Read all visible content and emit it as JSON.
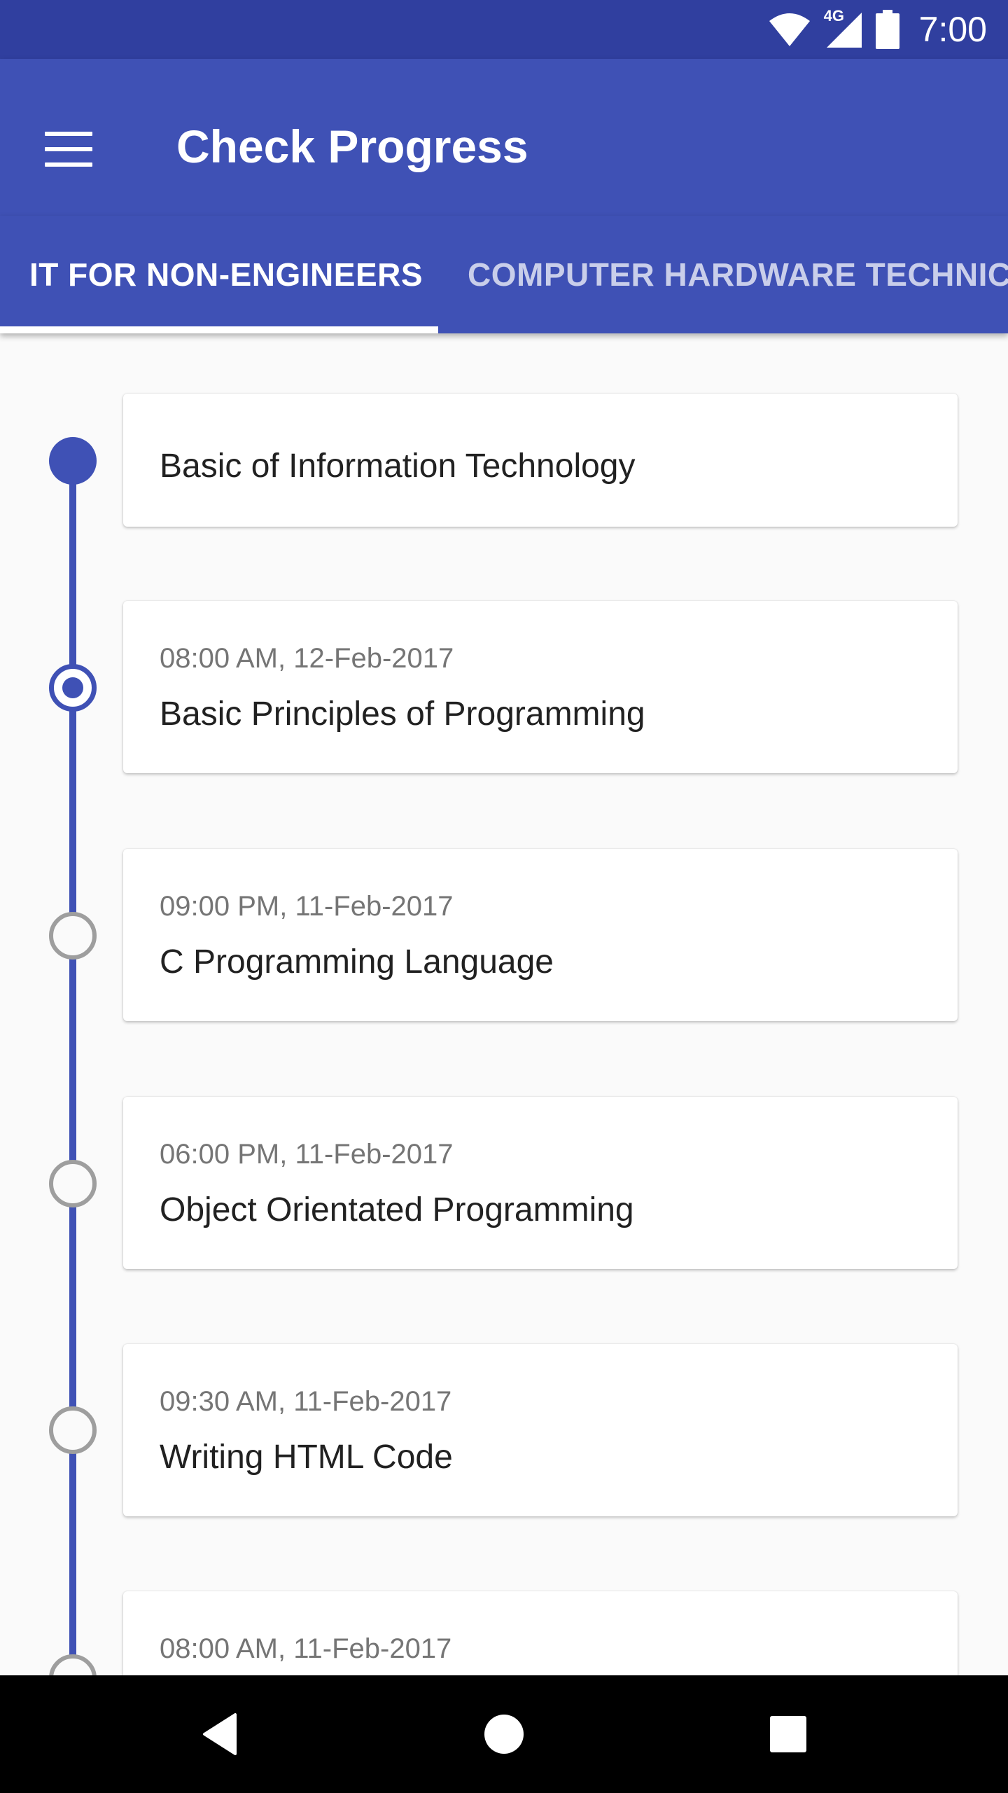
{
  "status_bar": {
    "time": "7:00",
    "network": "4G"
  },
  "app_bar": {
    "title": "Check Progress"
  },
  "tabs": [
    {
      "label": "IT FOR NON-ENGINEERS",
      "active": true
    },
    {
      "label": "COMPUTER HARDWARE TECHNICIAN",
      "active": false
    }
  ],
  "timeline": [
    {
      "time": "",
      "title": "Basic of Information Technology",
      "state": "completed"
    },
    {
      "time": "08:00 AM, 12-Feb-2017",
      "title": "Basic Principles of Programming",
      "state": "current"
    },
    {
      "time": "09:00 PM, 11-Feb-2017",
      "title": "C Programming Language",
      "state": "pending"
    },
    {
      "time": "06:00 PM, 11-Feb-2017",
      "title": "Object Orientated Programming",
      "state": "pending"
    },
    {
      "time": "09:30 AM, 11-Feb-2017",
      "title": "Writing HTML Code",
      "state": "pending"
    },
    {
      "time": "08:00 AM, 11-Feb-2017",
      "title": "",
      "state": "pending"
    }
  ],
  "colors": {
    "primary": "#3f51b5",
    "primary_dark": "#303f9f",
    "pending_node": "#9e9e9e"
  }
}
